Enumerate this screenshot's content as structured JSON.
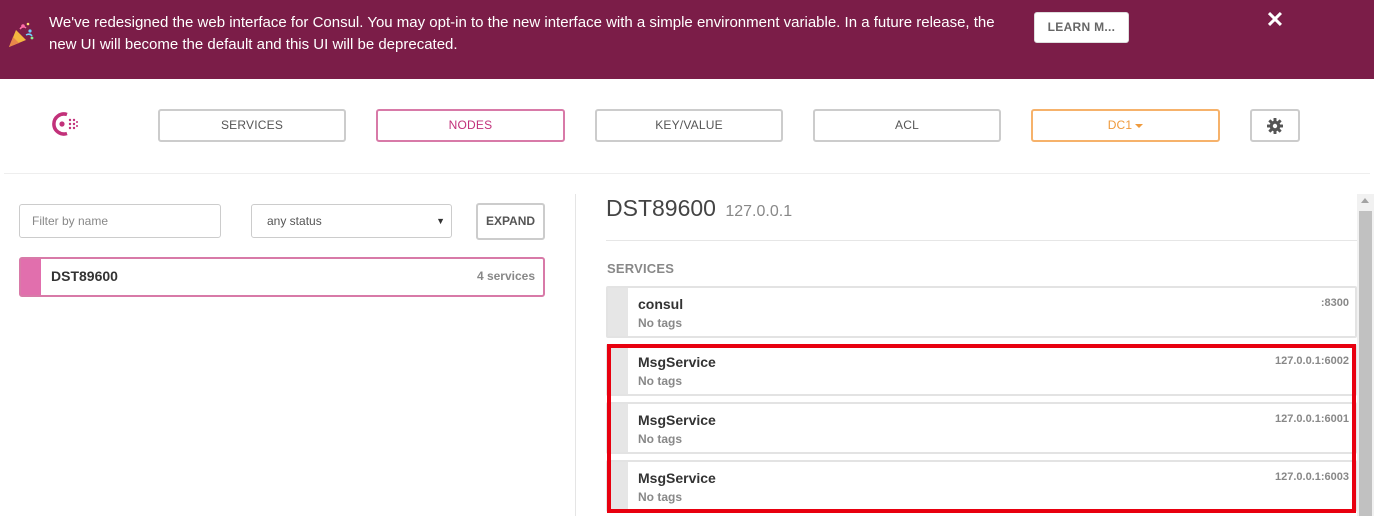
{
  "banner": {
    "message": "We've redesigned the web interface for Consul. You may opt-in to the new interface with a simple environment variable. In a future release, the new UI will become the default and this UI will be deprecated.",
    "learn_label": "LEARN M...",
    "close_label": "✕"
  },
  "nav": {
    "services": "SERVICES",
    "nodes": "NODES",
    "keyvalue": "KEY/VALUE",
    "acl": "ACL",
    "datacenter": "DC1"
  },
  "filter": {
    "placeholder": "Filter by name",
    "status": "any status",
    "expand_label": "EXPAND"
  },
  "nodes": [
    {
      "name": "DST89600",
      "count": "4 services"
    }
  ],
  "detail": {
    "name": "DST89600",
    "address": "127.0.0.1",
    "section_label": "SERVICES",
    "services": [
      {
        "name": "consul",
        "tags": "No tags",
        "port": ":8300"
      },
      {
        "name": "MsgService",
        "tags": "No tags",
        "port": "127.0.0.1:6002"
      },
      {
        "name": "MsgService",
        "tags": "No tags",
        "port": "127.0.0.1:6001"
      },
      {
        "name": "MsgService",
        "tags": "No tags",
        "port": "127.0.0.1:6003"
      }
    ]
  },
  "colors": {
    "banner": "#7b1d48",
    "brand": "#c2317a",
    "datacenter": "#ef9a3c",
    "highlight": "#e8000f"
  }
}
